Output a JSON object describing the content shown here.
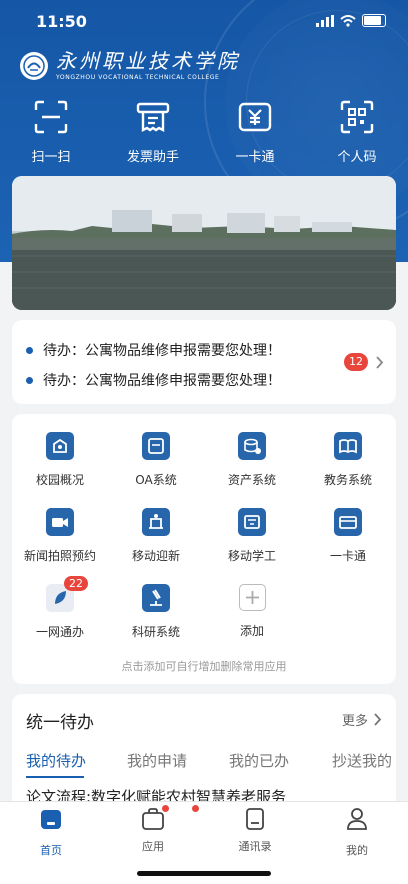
{
  "status": {
    "time": "11:50"
  },
  "logo": {
    "cn": "永州职业技术学院",
    "en": "YONGZHOU VOCATIONAL TECHNICAL COLLEGE"
  },
  "quick_actions": [
    {
      "label": "扫一扫",
      "icon": "scan-icon"
    },
    {
      "label": "发票助手",
      "icon": "invoice-icon"
    },
    {
      "label": "一卡通",
      "icon": "card-yuan-icon"
    },
    {
      "label": "个人码",
      "icon": "qr-code-icon"
    }
  ],
  "todo": {
    "items": [
      "待办：公寓物品维修申报需要您处理！",
      "待办：公寓物品维修申报需要您处理！"
    ],
    "count": "12"
  },
  "apps": {
    "items": [
      {
        "label": "校园概况",
        "icon": "campus-overview-icon"
      },
      {
        "label": "OA系统",
        "icon": "oa-icon"
      },
      {
        "label": "资产系统",
        "icon": "asset-icon"
      },
      {
        "label": "教务系统",
        "icon": "book-icon"
      },
      {
        "label": "新闻拍照预约",
        "icon": "video-camera-icon"
      },
      {
        "label": "移动迎新",
        "icon": "welcome-icon"
      },
      {
        "label": "移动学工",
        "icon": "student-work-icon"
      },
      {
        "label": "一卡通",
        "icon": "wallet-card-icon"
      },
      {
        "label": "一网通办",
        "icon": "leaf-icon",
        "badge": "22"
      },
      {
        "label": "科研系统",
        "icon": "microscope-icon"
      },
      {
        "label": "添加",
        "icon": "add-icon"
      }
    ],
    "hint": "点击添加可自行增加删除常用应用"
  },
  "pending": {
    "title": "统一待办",
    "more": "更多",
    "tabs": [
      "我的待办",
      "我的申请",
      "我的已办",
      "抄送我的"
    ],
    "active_tab": "我的待办",
    "first_item": "论文流程:数字化赋能农村智慧养老服务"
  },
  "nav": [
    {
      "label": "首页",
      "icon": "home-icon",
      "active": true
    },
    {
      "label": "应用",
      "icon": "apps-bag-icon",
      "dot": true
    },
    {
      "label": "通讯录",
      "icon": "contacts-icon",
      "dot": true
    },
    {
      "label": "我的",
      "icon": "profile-icon"
    }
  ],
  "colors": {
    "primary": "#1a5fb0",
    "badge": "#e8453c",
    "background": "#f2f3f5"
  }
}
